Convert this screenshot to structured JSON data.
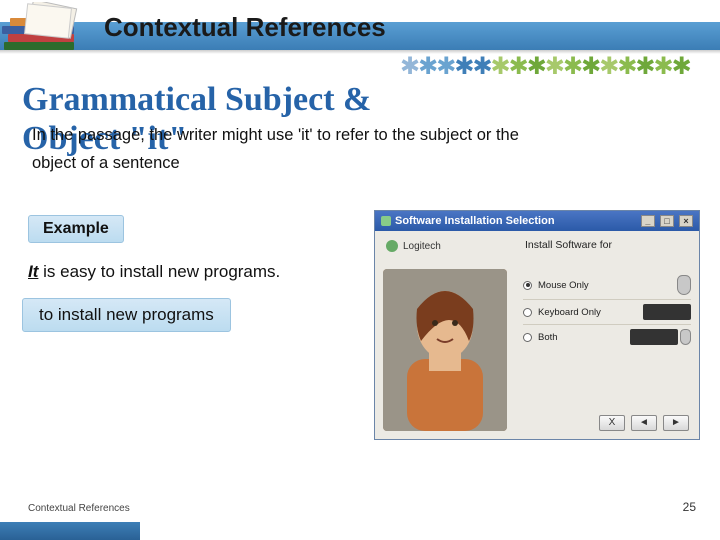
{
  "header": {
    "title": "Contextual References"
  },
  "heading_line1": "Grammatical Subject &",
  "heading_line2": "Object \"it\"",
  "overlap_prefix": "In the passage, the writer might use 'it' to refer to the subject or the",
  "body_text": "object of a sentence",
  "example_label": "Example",
  "sentence_it": "It",
  "sentence_rest": " is easy to install new programs.",
  "answer": "to install new programs",
  "footer": {
    "label": "Contextual References",
    "page": "25"
  },
  "window": {
    "title": "Software Installation Selection",
    "brand": "Logitech",
    "heading": "Install Software for",
    "options": [
      {
        "label": "Mouse Only",
        "selected": true,
        "device": "mouse"
      },
      {
        "label": "Keyboard Only",
        "selected": false,
        "device": "keyboard"
      },
      {
        "label": "Both",
        "selected": false,
        "device": "both"
      }
    ],
    "nav": {
      "back": "◄",
      "fwd": "►",
      "close": "X"
    }
  },
  "star_colors": [
    "#93b6d8",
    "#6aa3d0",
    "#6aa3d0",
    "#3f7fb8",
    "#3f7fb8",
    "#a7c96b",
    "#8bbb4e",
    "#6fa83a",
    "#a7c96b",
    "#8bbb4e",
    "#6fa83a",
    "#a7c96b",
    "#8bbb4e",
    "#6fa83a",
    "#8bbb4e",
    "#6fa83a"
  ]
}
